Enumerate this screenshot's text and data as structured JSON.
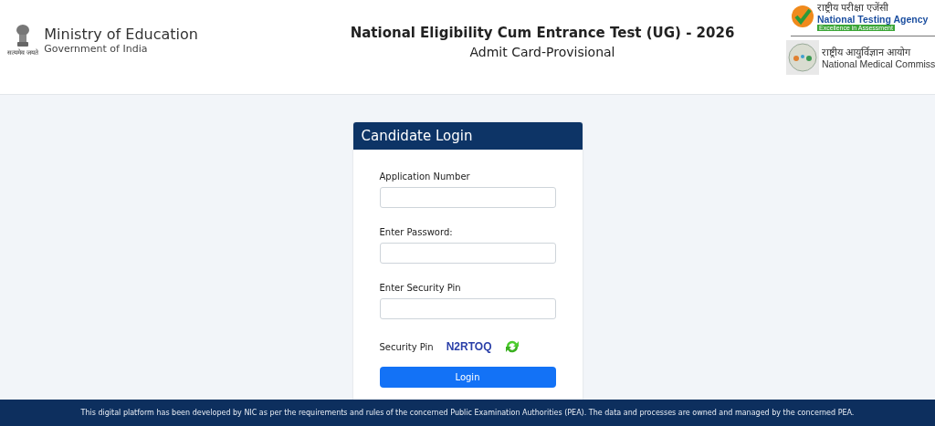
{
  "header": {
    "ministry": {
      "motto": "सत्यमेव जयते",
      "title": "Ministry of Education",
      "subtitle": "Government of India"
    },
    "title": "National Eligibility Cum Entrance Test (UG) - 2026",
    "subtitle": "Admit Card-Provisional",
    "nta": {
      "hindi": "राष्ट्रीय परीक्षा एजेंसी",
      "name": "National Testing Agency",
      "tagline": "Excellence in Assessment"
    },
    "nmc": {
      "hindi": "राष्ट्रीय आयुर्विज्ञान आयोग",
      "name": "National Medical Commiss"
    }
  },
  "login": {
    "title": "Candidate Login",
    "fields": [
      {
        "label": "Application Number"
      },
      {
        "label": "Enter Password:"
      },
      {
        "label": "Enter Security Pin"
      }
    ],
    "security_pin": {
      "label": "Security Pin",
      "code": "N2RTOQ"
    },
    "button": "Login"
  },
  "footer": "This digital platform has been developed by NIC as per the requirements and rules of the concerned Public Examination Authorities (PEA). The data and processes are owned and managed by the concerned PEA."
}
